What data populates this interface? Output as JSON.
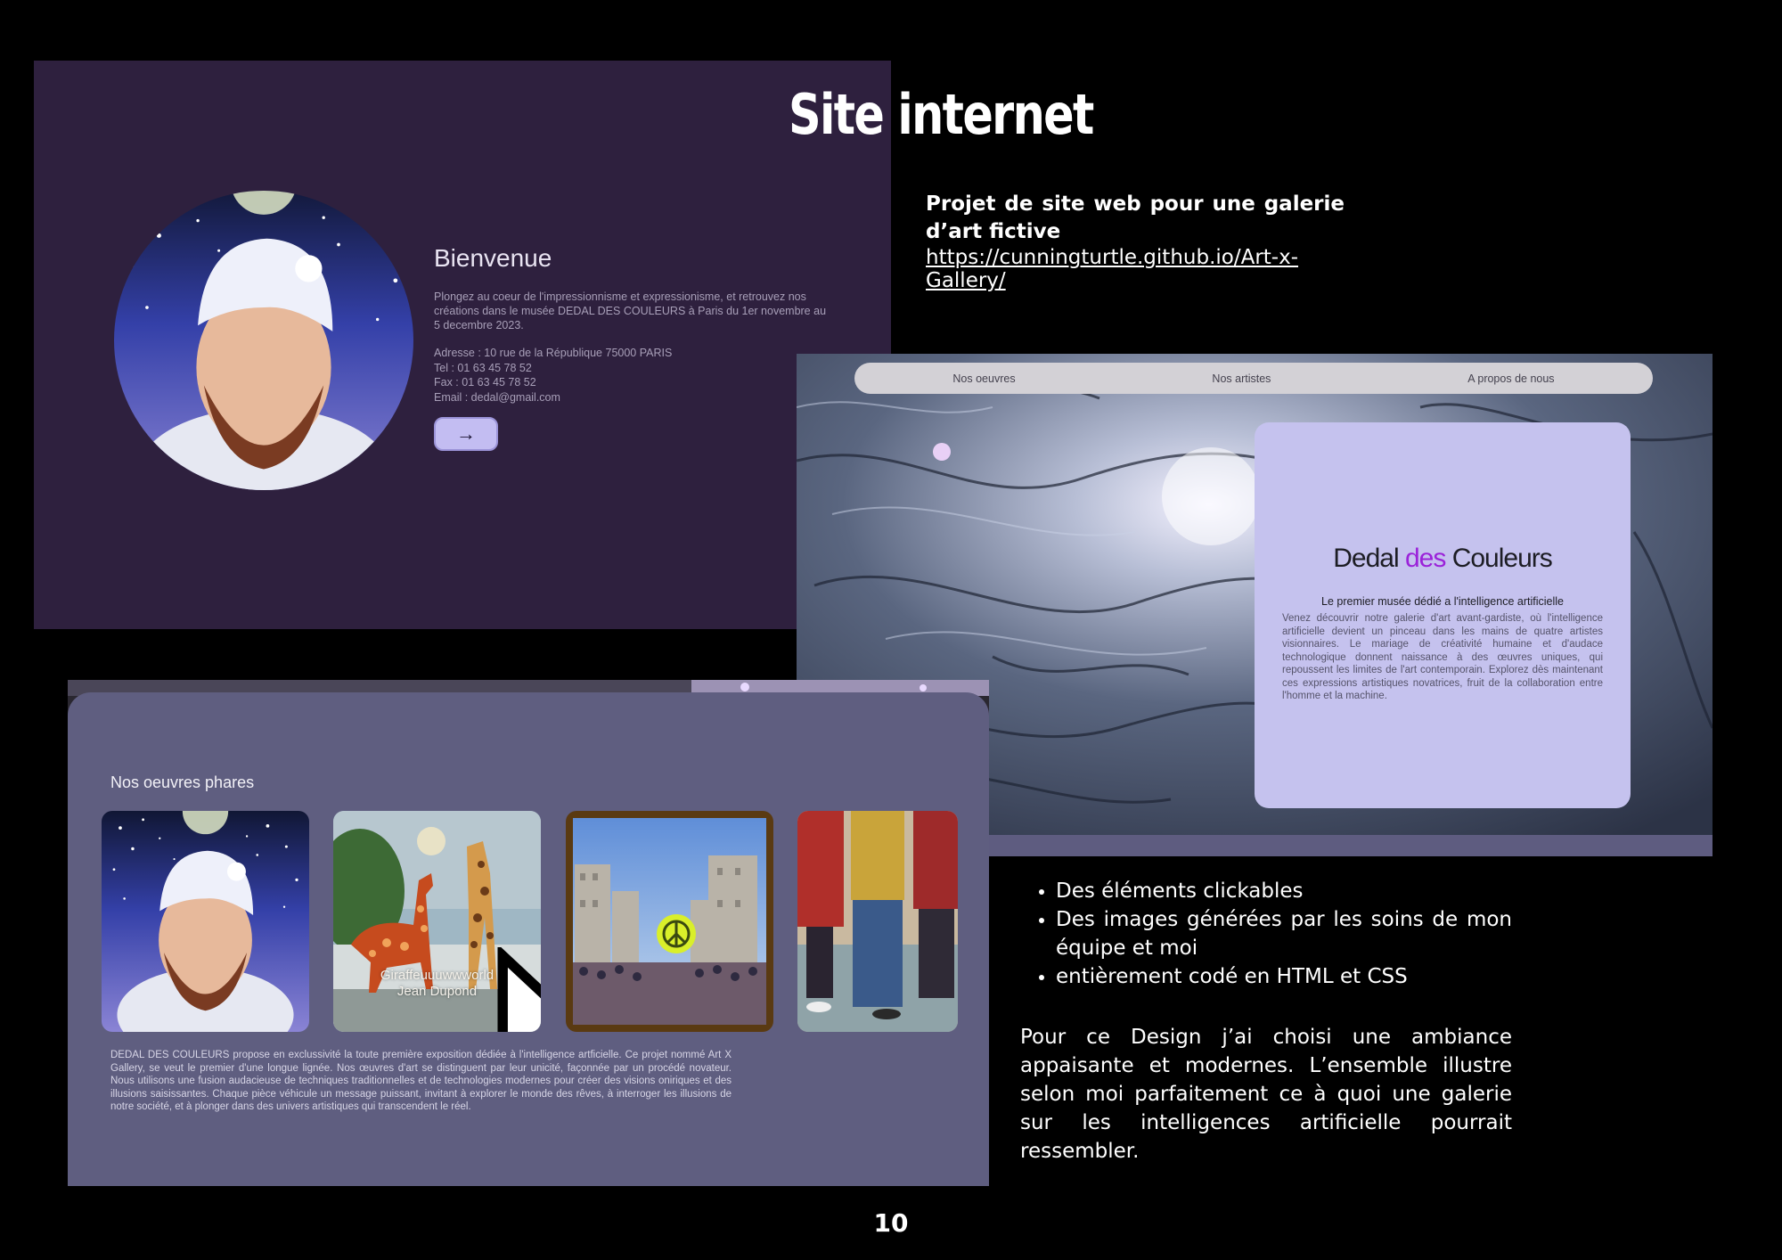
{
  "slide": {
    "title": "Site internet",
    "intro_heading": "Projet de site web pour une galerie d’art fictive",
    "intro_link": "https://cunningturtle.github.io/Art-x-Gallery/",
    "features": [
      "Des éléments clickables",
      "Des images générées par les soins de mon équipe et moi",
      "entièrement codé en HTML et CSS"
    ],
    "design_text": "Pour ce Design j’ai choisi une ambiance appaisante et modernes. L’ensemble illustre selon moi parfaitement ce à quoi une galerie sur les intelligences artificielle pourrait ressembler.",
    "page_number": "10"
  },
  "welcome": {
    "title": "Bienvenue",
    "description": "Plongez au coeur de l'impressionnisme et expressionisme, et retrouvez nos créations dans le musée DEDAL DES COULEURS à Paris du 1er novembre au 5 decembre 2023.",
    "address": "Adresse : 10 rue de la République 75000 PARIS",
    "tel": "Tel : 01 63 45 78 52",
    "fax": "Fax : 01 63 45 78 52",
    "email": "Email : dedal@gmail.com",
    "button_icon": "arrow-right-icon",
    "button_glyph": "→"
  },
  "hero": {
    "nav": [
      "Nos oeuvres",
      "Nos artistes",
      "A propos de nous"
    ],
    "brand_part1": "Dedal",
    "brand_part2": "des",
    "brand_part3": "Couleurs",
    "subtitle": "Le premier musée dédié a l'intelligence artificielle",
    "text": "Venez découvrir notre galerie d'art avant-gardiste, où l'intelligence artificielle devient un pinceau dans les mains de quatre artistes visionnaires. Le mariage de créativité humaine et d'audace technologique donnent naissance à des œuvres uniques, qui repoussent les limites de l'art contemporain. Explorez dès maintenant ces expressions artistiques novatrices, fruit de la collaboration entre l'homme et la machine.",
    "colors": {
      "brand": "#1d1d24",
      "accent": "#9b22d9",
      "card": "#c5c2ee"
    }
  },
  "gallery": {
    "title": "Nos oeuvres phares",
    "artworks": [
      {
        "name": "portrait-artwork"
      },
      {
        "name": "giraffe-artwork",
        "caption_title": "Giraffeuuuwwworld",
        "caption_artist": "Jean Dupond"
      },
      {
        "name": "city-crowd-artwork"
      },
      {
        "name": "people-artwork"
      }
    ],
    "description": "DEDAL DES COULEURS propose en exclussivité la toute première exposition dédiée à l'intelligence artficielle. Ce projet nommé Art X Gallery, se veut le premier d'une longue lignée. Nos œuvres d'art se distinguent par leur unicité, façonnée par un procédé novateur. Nous utilisons une fusion audacieuse de techniques traditionnelles et de technologies modernes pour créer des visions oniriques et des illusions saisissantes. Chaque pièce véhicule un message puissant, invitant à explorer le monde des rêves, à interroger les illusions de notre société, et à plonger dans des univers artistiques qui transcendent le réel."
  }
}
